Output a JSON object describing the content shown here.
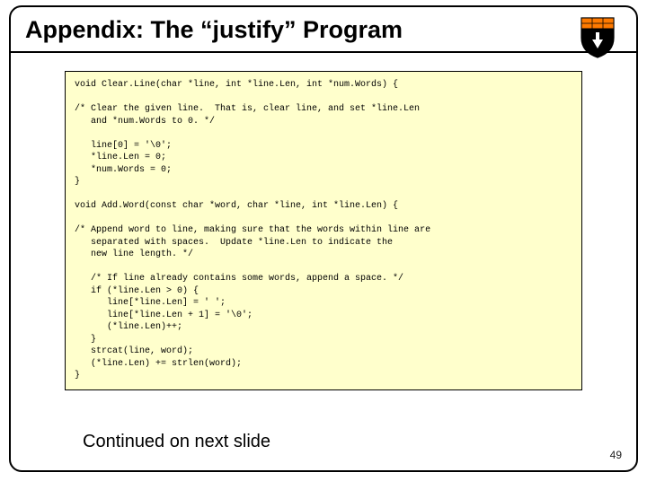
{
  "title": "Appendix: The “justify” Program",
  "code": "void Clear.Line(char *line, int *line.Len, int *num.Words) {\n\n/* Clear the given line.  That is, clear line, and set *line.Len\n   and *num.Words to 0. */\n\n   line[0] = '\\0';\n   *line.Len = 0;\n   *num.Words = 0;\n}\n\nvoid Add.Word(const char *word, char *line, int *line.Len) {\n\n/* Append word to line, making sure that the words within line are\n   separated with spaces.  Update *line.Len to indicate the\n   new line length. */\n\n   /* If line already contains some words, append a space. */\n   if (*line.Len > 0) {\n      line[*line.Len] = ' ';\n      line[*line.Len + 1] = '\\0';\n      (*line.Len)++;\n   }\n   strcat(line, word);\n   (*line.Len) += strlen(word);\n}",
  "continued": "Continued on next slide",
  "pagenum": "49"
}
